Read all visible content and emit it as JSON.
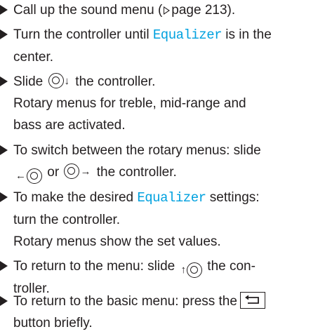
{
  "steps": [
    {
      "lines": [
        "Call up the sound menu (",
        "page 213)."
      ]
    },
    {
      "lines": [
        "Turn the controller until ",
        "Equalizer",
        " is in the",
        "center."
      ]
    },
    {
      "lines": [
        "Slide ",
        " the controller.",
        "Rotary menus for treble, mid-range and",
        "bass are activated."
      ]
    },
    {
      "lines": [
        "To switch between the rotary menus: slide",
        " or ",
        " the controller."
      ]
    },
    {
      "lines": [
        "To make the desired ",
        "Equalizer",
        " settings:",
        "turn the controller.",
        "Rotary menus show the set values."
      ]
    },
    {
      "lines": [
        "To return to the menu: slide ",
        " the con-",
        "troller."
      ]
    },
    {
      "lines": [
        "To return to the basic menu: press the",
        "button briefly."
      ]
    }
  ],
  "colors": {
    "highlight": "#00a1df",
    "text": "#231f20"
  },
  "icons": {
    "bullet": "triangle-bullet-icon",
    "page_ref": "page-reference-triangle-icon",
    "controller": "controller-dial-icon",
    "back": "back-button-icon"
  }
}
